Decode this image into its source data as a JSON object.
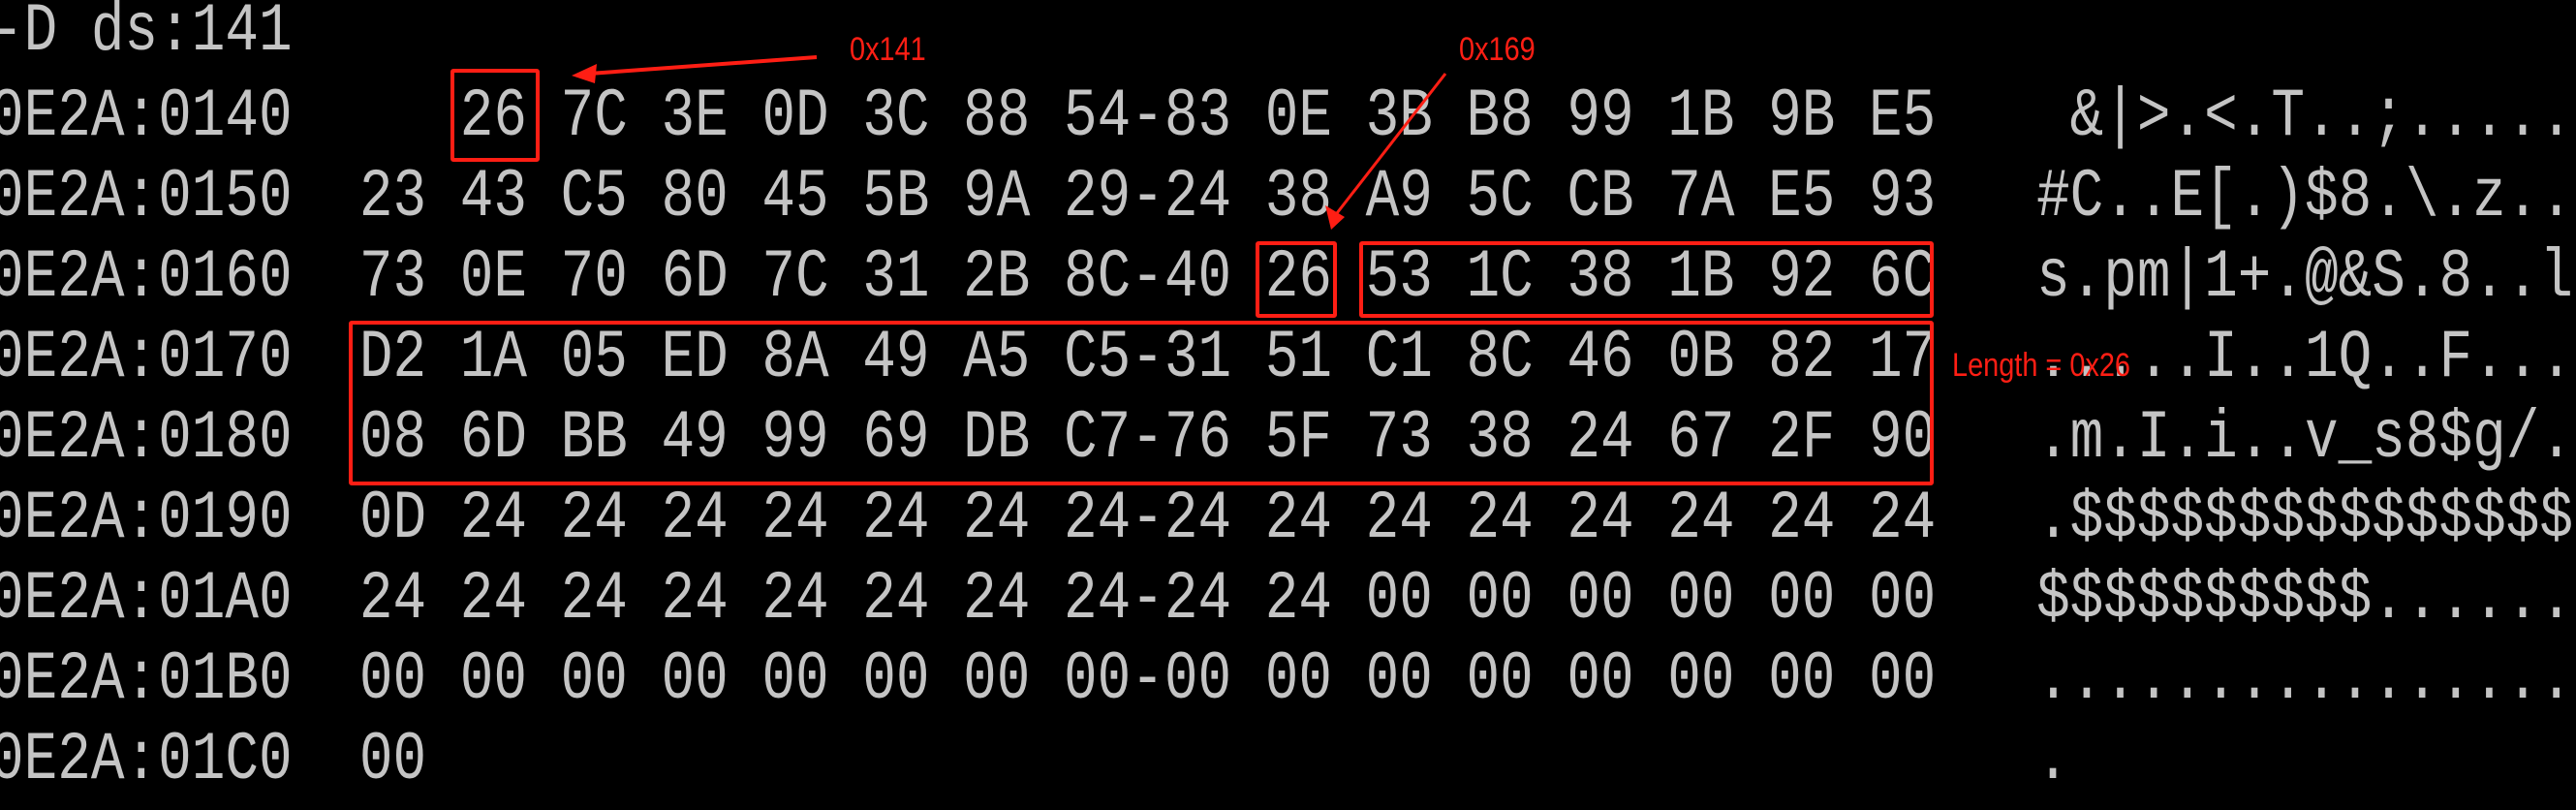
{
  "command": "-D ds:141",
  "rows": [
    {
      "address": "0E2A:0140",
      "bytes": [
        null,
        "26",
        "7C",
        "3E",
        "0D",
        "3C",
        "88",
        "54",
        "83",
        "0E",
        "3B",
        "B8",
        "99",
        "1B",
        "9B",
        "E5"
      ],
      "ascii": " &|>.<.T..;....."
    },
    {
      "address": "0E2A:0150",
      "bytes": [
        "23",
        "43",
        "C5",
        "80",
        "45",
        "5B",
        "9A",
        "29",
        "24",
        "38",
        "A9",
        "5C",
        "CB",
        "7A",
        "E5",
        "93"
      ],
      "ascii": "#C..E[.)$8.\\.z.."
    },
    {
      "address": "0E2A:0160",
      "bytes": [
        "73",
        "0E",
        "70",
        "6D",
        "7C",
        "31",
        "2B",
        "8C",
        "40",
        "26",
        "53",
        "1C",
        "38",
        "1B",
        "92",
        "6C"
      ],
      "ascii": "s.pm|1+.@&S.8..l"
    },
    {
      "address": "0E2A:0170",
      "bytes": [
        "D2",
        "1A",
        "05",
        "ED",
        "8A",
        "49",
        "A5",
        "C5",
        "31",
        "51",
        "C1",
        "8C",
        "46",
        "0B",
        "82",
        "17"
      ],
      "ascii": ".....I..1Q..F..."
    },
    {
      "address": "0E2A:0180",
      "bytes": [
        "08",
        "6D",
        "BB",
        "49",
        "99",
        "69",
        "DB",
        "C7",
        "76",
        "5F",
        "73",
        "38",
        "24",
        "67",
        "2F",
        "90"
      ],
      "ascii": ".m.I.i..v_s8$g/."
    },
    {
      "address": "0E2A:0190",
      "bytes": [
        "0D",
        "24",
        "24",
        "24",
        "24",
        "24",
        "24",
        "24",
        "24",
        "24",
        "24",
        "24",
        "24",
        "24",
        "24",
        "24"
      ],
      "ascii": ".$$$$$$$$$$$$$$$"
    },
    {
      "address": "0E2A:01A0",
      "bytes": [
        "24",
        "24",
        "24",
        "24",
        "24",
        "24",
        "24",
        "24",
        "24",
        "24",
        "00",
        "00",
        "00",
        "00",
        "00",
        "00"
      ],
      "ascii": "$$$$$$$$$$......"
    },
    {
      "address": "0E2A:01B0",
      "bytes": [
        "00",
        "00",
        "00",
        "00",
        "00",
        "00",
        "00",
        "00",
        "00",
        "00",
        "00",
        "00",
        "00",
        "00",
        "00",
        "00"
      ],
      "ascii": "................"
    },
    {
      "address": "0E2A:01C0",
      "bytes": [
        "00"
      ],
      "ascii": "."
    }
  ],
  "annotations": {
    "start_label": "0x141",
    "second_label": "0x169",
    "length_label": "Length = 0x26"
  },
  "colors": {
    "text": "#c4c4c4",
    "annotation": "#ff1e14",
    "background": "#000000"
  }
}
